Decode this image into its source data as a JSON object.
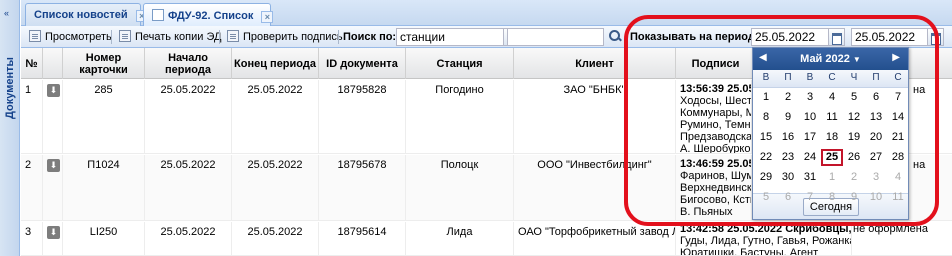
{
  "sidebar": {
    "label": "Документы",
    "collapse_icon": "double-chevron-left"
  },
  "tabs": [
    {
      "label": "Список новостей"
    },
    {
      "label": "ФДУ-92. Список"
    }
  ],
  "toolbar": {
    "view_label": "Просмотреть",
    "print_label": "Печать копии ЭД",
    "verify_label": "Проверить подпись",
    "search_by_label": "Поиск по:",
    "search_field_value": "станции",
    "search_text_value": "",
    "period_label": "Показывать на период с",
    "date_from": "25.05.2022",
    "to_label": "по",
    "date_to": "25.05.2022"
  },
  "columns": [
    "№",
    "",
    "Номер карточки",
    "Начало периода",
    "Конец периода",
    "ID документа",
    "Станция",
    "Клиент",
    "Подписи"
  ],
  "rows": [
    {
      "num": "1",
      "card": "285",
      "start": "25.05.2022",
      "end": "25.05.2022",
      "doc_id": "18795828",
      "station": "Погодино",
      "client": "ЗАО \"БНБК\"",
      "signature_lines": [
        "13:56:39 25.05",
        "Ходосы, Шестер",
        "Коммунары, Мих",
        "Румино, Темный",
        "Предзаводская,",
        "А. Шеробурко"
      ],
      "tail": "на"
    },
    {
      "num": "2",
      "card": "П1024",
      "start": "25.05.2022",
      "end": "25.05.2022",
      "doc_id": "18795678",
      "station": "Полоцк",
      "client": "ООО \"Инвестбилдинг\"",
      "signature_lines": [
        "13:46:59 25.05",
        "Фаринов, Шуми",
        "Верхнедвинск, С",
        "Бигосово, Ксты,",
        "В. Пьяных"
      ],
      "tail": "на"
    },
    {
      "num": "3",
      "card": "LI250",
      "start": "25.05.2022",
      "end": "25.05.2022",
      "doc_id": "18795614",
      "station": "Лида",
      "client": "ОАО \"Торфобрикетный завод Л...",
      "signature_lines": [
        "13:42:58 25.05.2022 Скрибовцы,",
        "Гуды, Лида, Гутно, Гавья, Рожанка,",
        "Юратишки, Бастуны, Агент"
      ],
      "tail": "не оформлена"
    }
  ],
  "datepicker": {
    "month_label": "Май 2022",
    "weekdays": [
      "В",
      "П",
      "В",
      "С",
      "Ч",
      "П",
      "С"
    ],
    "weeks": [
      [
        "1",
        "2",
        "3",
        "4",
        "5",
        "6",
        "7"
      ],
      [
        "8",
        "9",
        "10",
        "11",
        "12",
        "13",
        "14"
      ],
      [
        "15",
        "16",
        "17",
        "18",
        "19",
        "20",
        "21"
      ],
      [
        "22",
        "23",
        "24",
        "25",
        "26",
        "27",
        "28"
      ],
      [
        "29",
        "30",
        "31",
        "1",
        "2",
        "3",
        "4"
      ],
      [
        "5",
        "6",
        "7",
        "8",
        "9",
        "10",
        "11"
      ]
    ],
    "selected_day": "25",
    "today_label": "Сегодня",
    "colors": {
      "header": "#23508e",
      "highlight_ring": "#e3101c",
      "selected": "#c3142a"
    }
  }
}
